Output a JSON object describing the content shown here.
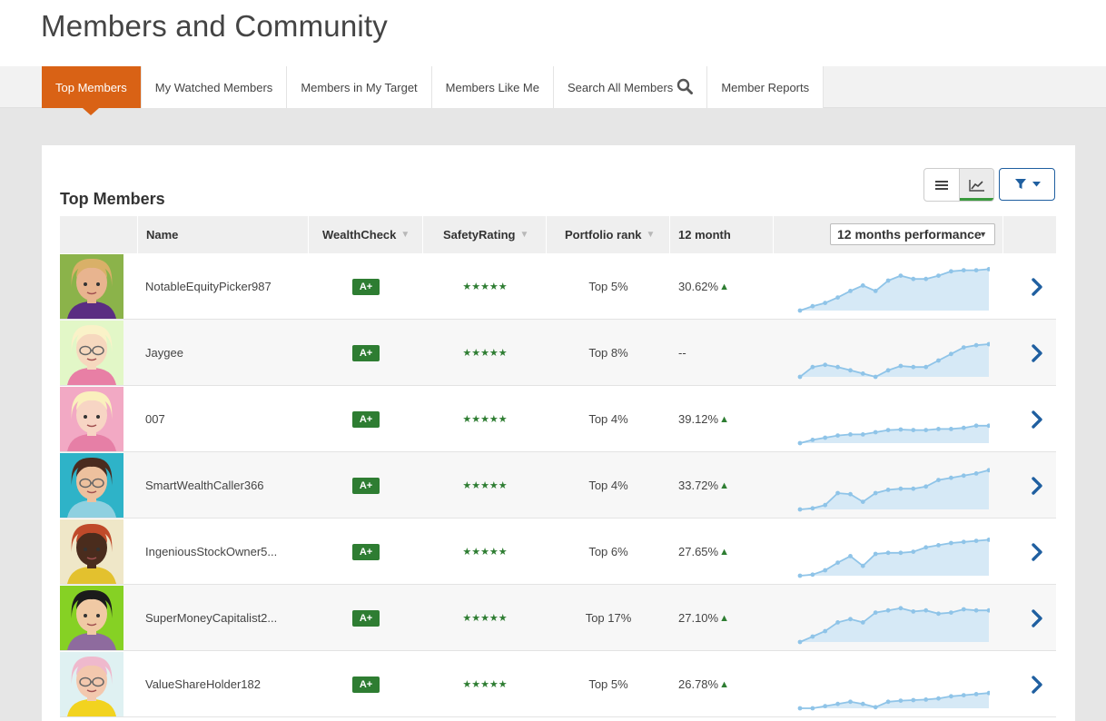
{
  "page": {
    "title": "Members and Community"
  },
  "tabs": [
    {
      "label": "Top Members",
      "active": true
    },
    {
      "label": "My Watched Members"
    },
    {
      "label": "Members in My Target"
    },
    {
      "label": "Members Like Me"
    },
    {
      "label": "Search All Members",
      "icon": "search-icon"
    },
    {
      "label": "Member Reports"
    }
  ],
  "section": {
    "title": "Top Members"
  },
  "toolbar": {
    "list_view_icon": "list-icon",
    "chart_view_icon": "trend-chart-icon",
    "filter_icon": "filter-icon",
    "active_view": "chart"
  },
  "columns": {
    "name": "Name",
    "wealthcheck": "WealthCheck",
    "safety": "SafetyRating",
    "rank": "Portfolio rank",
    "perf": "12 month",
    "chart_select": "12 months performance"
  },
  "colors": {
    "accent": "#d96215",
    "grade": "#2e7d32",
    "link": "#1f5fa0",
    "spark_fill": "#d6e9f6",
    "spark_line": "#8fc4e8"
  },
  "members": [
    {
      "name": "NotableEquityPicker987",
      "wealthcheck": "A+",
      "safety": "★★★★★",
      "rank": "Top 5%",
      "perf": "30.62%",
      "trend": "up",
      "avatar": {
        "bg": "#8bb34a",
        "skin": "#e8b48f",
        "hair": "#d9b068",
        "shirt": "#5a2d82",
        "glasses": false
      },
      "spark": [
        0,
        8,
        14,
        24,
        36,
        46,
        36,
        55,
        64,
        58,
        58,
        64,
        72,
        74,
        74,
        76
      ]
    },
    {
      "name": "Jaygee",
      "wealthcheck": "A+",
      "safety": "★★★★★",
      "rank": "Top 8%",
      "perf": "--",
      "trend": "",
      "avatar": {
        "bg": "#e2f7c7",
        "skin": "#f6d8be",
        "hair": "#faf2c8",
        "shirt": "#e87fa5",
        "glasses": true
      },
      "spark": [
        0,
        18,
        22,
        18,
        12,
        6,
        0,
        12,
        20,
        18,
        18,
        30,
        42,
        54,
        58,
        60
      ]
    },
    {
      "name": "007",
      "wealthcheck": "A+",
      "safety": "★★★★★",
      "rank": "Top 4%",
      "perf": "39.12%",
      "trend": "up",
      "avatar": {
        "bg": "#f2a9c4",
        "skin": "#f7d5c4",
        "hair": "#faf0bd",
        "shirt": "#e67fa6",
        "glasses": false
      },
      "spark": [
        0,
        6,
        10,
        14,
        16,
        16,
        20,
        24,
        25,
        24,
        24,
        26,
        26,
        28,
        32,
        32
      ]
    },
    {
      "name": "SmartWealthCaller366",
      "wealthcheck": "A+",
      "safety": "★★★★★",
      "rank": "Top 4%",
      "perf": "33.72%",
      "trend": "up",
      "avatar": {
        "bg": "#2eb3c8",
        "skin": "#edc19e",
        "hair": "#4a2b1f",
        "shirt": "#8fd0e0",
        "glasses": true
      },
      "spark": [
        0,
        2,
        8,
        30,
        28,
        14,
        30,
        36,
        38,
        38,
        42,
        54,
        58,
        62,
        66,
        72
      ]
    },
    {
      "name": "IngeniousStockOwner5...",
      "wealthcheck": "A+",
      "safety": "★★★★★",
      "rank": "Top 6%",
      "perf": "27.65%",
      "trend": "up",
      "avatar": {
        "bg": "#efe7c8",
        "skin": "#4a2c1d",
        "hair": "#c04a2a",
        "shirt": "#e3c12e",
        "glasses": false
      },
      "spark": [
        0,
        2,
        10,
        24,
        36,
        18,
        40,
        42,
        42,
        44,
        52,
        56,
        60,
        62,
        64,
        66
      ]
    },
    {
      "name": "SuperMoneyCapitalist2...",
      "wealthcheck": "A+",
      "safety": "★★★★★",
      "rank": "Top 17%",
      "perf": "27.10%",
      "trend": "up",
      "avatar": {
        "bg": "#86d124",
        "skin": "#f0c9a4",
        "hair": "#1b1b1b",
        "shirt": "#8e6b9e",
        "glasses": false
      },
      "spark": [
        0,
        10,
        20,
        36,
        42,
        36,
        54,
        58,
        62,
        56,
        58,
        52,
        54,
        60,
        58,
        58
      ]
    },
    {
      "name": "ValueShareHolder182",
      "wealthcheck": "A+",
      "safety": "★★★★★",
      "rank": "Top 5%",
      "perf": "26.78%",
      "trend": "up",
      "avatar": {
        "bg": "#dff1f2",
        "skin": "#f3c8ae",
        "hair": "#efb9cd",
        "shirt": "#f2d31f",
        "glasses": true
      },
      "spark": [
        0,
        0,
        4,
        8,
        12,
        8,
        2,
        12,
        14,
        15,
        16,
        18,
        22,
        24,
        26,
        28
      ]
    }
  ]
}
